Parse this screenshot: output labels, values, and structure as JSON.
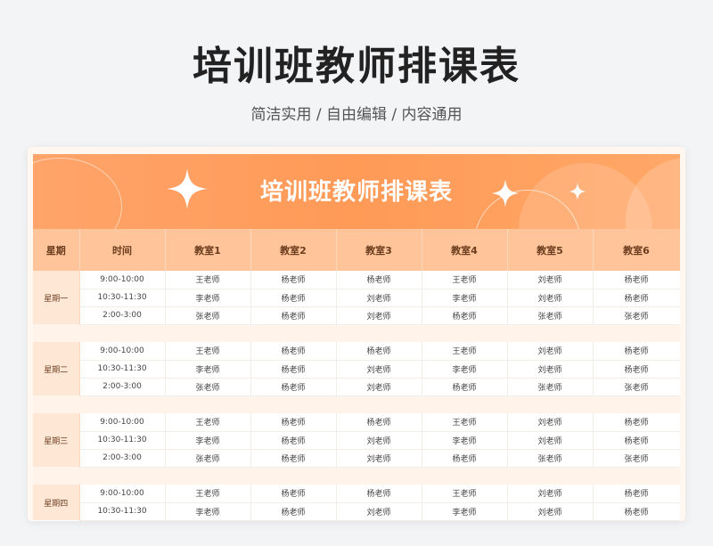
{
  "header": {
    "title": "培训班教师排课表",
    "subtitle": "简洁实用 / 自由编辑 / 内容通用"
  },
  "banner": {
    "title": "培训班教师排课表"
  },
  "table": {
    "columns": [
      "星期",
      "时间",
      "教室1",
      "教室2",
      "教室3",
      "教室4",
      "教室5",
      "教室6"
    ],
    "days": [
      {
        "day": "星期一",
        "rows": [
          [
            "9:00-10:00",
            "王老师",
            "杨老师",
            "杨老师",
            "王老师",
            "刘老师",
            "杨老师"
          ],
          [
            "10:30-11:30",
            "李老师",
            "杨老师",
            "刘老师",
            "李老师",
            "刘老师",
            "杨老师"
          ],
          [
            "2:00-3:00",
            "张老师",
            "杨老师",
            "刘老师",
            "杨老师",
            "张老师",
            "张老师"
          ]
        ]
      },
      {
        "day": "星期二",
        "rows": [
          [
            "9:00-10:00",
            "王老师",
            "杨老师",
            "杨老师",
            "王老师",
            "刘老师",
            "杨老师"
          ],
          [
            "10:30-11:30",
            "李老师",
            "杨老师",
            "刘老师",
            "李老师",
            "刘老师",
            "杨老师"
          ],
          [
            "2:00-3:00",
            "张老师",
            "杨老师",
            "刘老师",
            "杨老师",
            "张老师",
            "张老师"
          ]
        ]
      },
      {
        "day": "星期三",
        "rows": [
          [
            "9:00-10:00",
            "王老师",
            "杨老师",
            "杨老师",
            "王老师",
            "刘老师",
            "杨老师"
          ],
          [
            "10:30-11:30",
            "李老师",
            "杨老师",
            "刘老师",
            "李老师",
            "刘老师",
            "杨老师"
          ],
          [
            "2:00-3:00",
            "张老师",
            "杨老师",
            "刘老师",
            "杨老师",
            "张老师",
            "张老师"
          ]
        ]
      },
      {
        "day": "星期四",
        "rows": [
          [
            "9:00-10:00",
            "王老师",
            "杨老师",
            "杨老师",
            "王老师",
            "刘老师",
            "杨老师"
          ],
          [
            "10:30-11:30",
            "李老师",
            "杨老师",
            "刘老师",
            "李老师",
            "刘老师",
            "杨老师"
          ]
        ]
      }
    ]
  },
  "colors": {
    "banner": "#ff9a57",
    "header_row": "#ffc49a",
    "day_cell": "#ffe7d6"
  }
}
